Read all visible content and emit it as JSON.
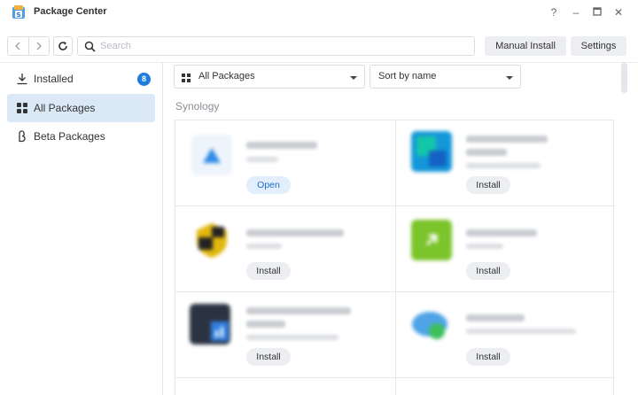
{
  "window": {
    "title": "Package Center"
  },
  "controls": {
    "help": "?",
    "minimize": "–",
    "close": "✕"
  },
  "toolbar": {
    "search_placeholder": "Search",
    "manual_install_label": "Manual Install",
    "settings_label": "Settings"
  },
  "sidebar": {
    "items": [
      {
        "label": "Installed",
        "badge": "8",
        "icon": "download-icon",
        "active": false
      },
      {
        "label": "All Packages",
        "icon": "grid-icon",
        "active": true
      },
      {
        "label": "Beta Packages",
        "icon": "beta-icon",
        "active": false
      }
    ]
  },
  "filters": {
    "category": "All Packages",
    "sort": "Sort by name"
  },
  "section": {
    "title": "Synology"
  },
  "packages": [
    {
      "action": "Open",
      "icon": "package-icon",
      "color": "#2f8ce6"
    },
    {
      "action": "Install",
      "icon": "package-icon",
      "color": "#1497d8"
    },
    {
      "action": "Install",
      "icon": "package-icon",
      "color": "#e2b80f"
    },
    {
      "action": "Install",
      "icon": "package-icon",
      "color": "#7cc42c"
    },
    {
      "action": "Install",
      "icon": "package-icon",
      "color": "#2b4670"
    },
    {
      "action": "Install",
      "icon": "package-icon",
      "color": "#4ea4e6"
    }
  ],
  "colors": {
    "accent": "#1d7de0",
    "active_bg": "#dbe9f7",
    "button_bg": "#eceef1"
  }
}
